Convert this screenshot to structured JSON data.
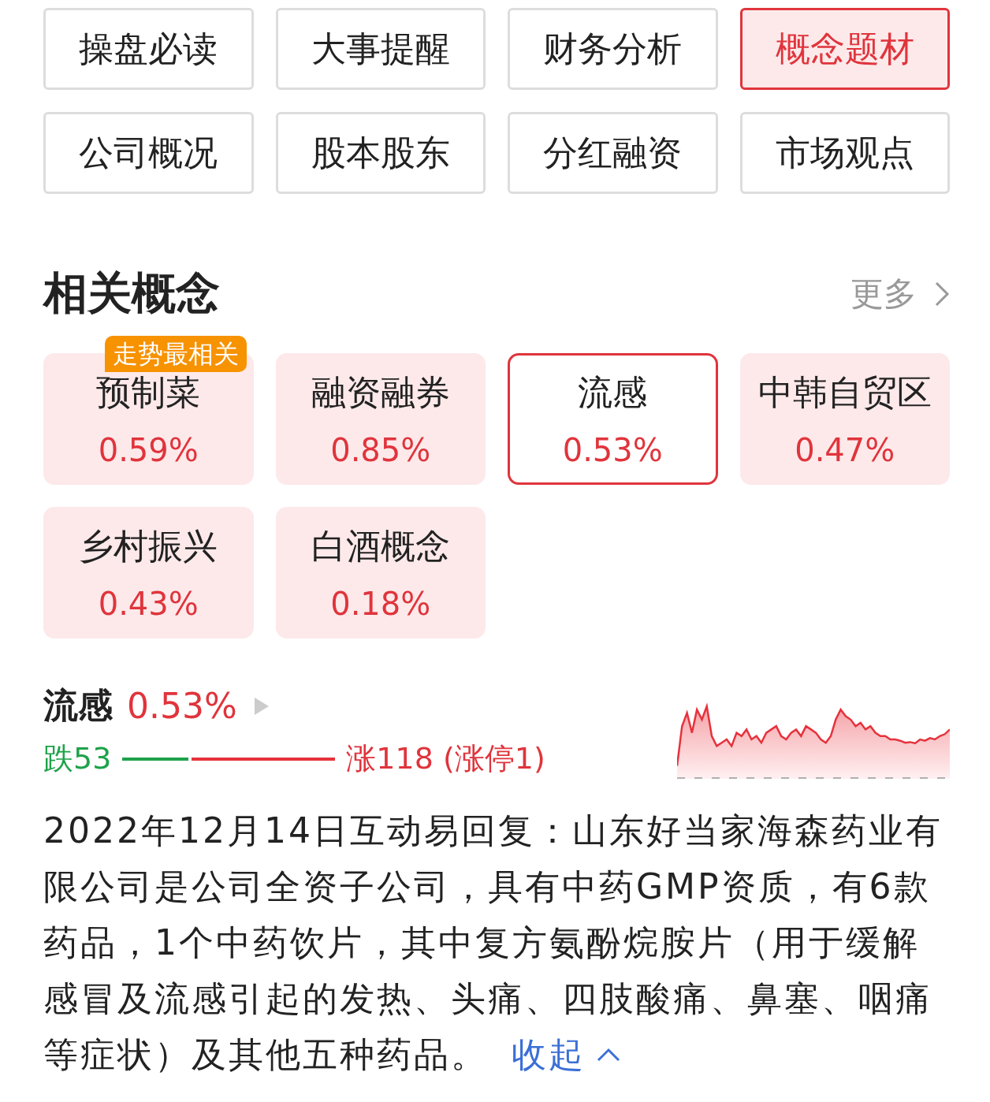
{
  "tabs": [
    {
      "label": "操盘必读",
      "selected": false
    },
    {
      "label": "大事提醒",
      "selected": false
    },
    {
      "label": "财务分析",
      "selected": false
    },
    {
      "label": "概念题材",
      "selected": true
    },
    {
      "label": "公司概况",
      "selected": false
    },
    {
      "label": "股本股东",
      "selected": false
    },
    {
      "label": "分红融资",
      "selected": false
    },
    {
      "label": "市场观点",
      "selected": false
    }
  ],
  "section": {
    "title": "相关概念",
    "more": "更多"
  },
  "concepts": [
    {
      "name": "预制菜",
      "change": "0.59%",
      "badge": "走势最相关",
      "selected": false
    },
    {
      "name": "融资融券",
      "change": "0.85%",
      "selected": false
    },
    {
      "name": "流感",
      "change": "0.53%",
      "selected": true
    },
    {
      "name": "中韩自贸区",
      "change": "0.47%",
      "selected": false
    },
    {
      "name": "乡村振兴",
      "change": "0.43%",
      "selected": false
    },
    {
      "name": "白酒概念",
      "change": "0.18%",
      "selected": false
    }
  ],
  "detail": {
    "name": "流感",
    "change": "0.53%",
    "fall": "跌53",
    "rise": "涨118 (涨停1)",
    "breadth": {
      "level": 0.31
    },
    "text": "2022年12月14日互动易回复：山东好当家海森药业有限公司是公司全资子公司，具有中药GMP资质，有6款药品，1个中药饮片，其中复方氨酚烷胺片（用于缓解感冒及流感引起的发热、头痛、四肢酸痛、鼻塞、咽痛等症状）及其他五种药品。",
    "collapse": "收起"
  }
}
